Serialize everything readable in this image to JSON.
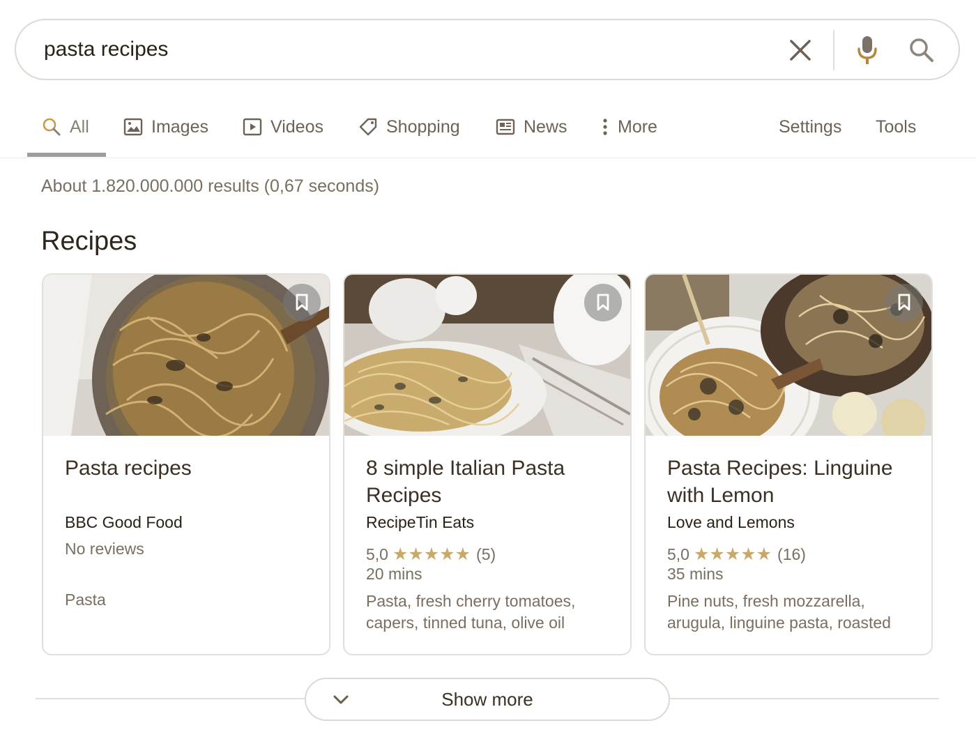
{
  "search": {
    "query": "pasta recipes"
  },
  "icons": {
    "clear": "close-icon",
    "mic": "microphone-icon",
    "search": "search-icon"
  },
  "tabs": [
    {
      "label": "All",
      "icon": "search-icon",
      "active": true
    },
    {
      "label": "Images",
      "icon": "image-icon"
    },
    {
      "label": "Videos",
      "icon": "play-icon"
    },
    {
      "label": "Shopping",
      "icon": "tag-icon"
    },
    {
      "label": "News",
      "icon": "newspaper-icon"
    },
    {
      "label": "More",
      "icon": "more-vert-icon"
    }
  ],
  "tools": {
    "settings": "Settings",
    "tools": "Tools"
  },
  "result_stats": "About 1.820.000.000 results (0,67 seconds)",
  "section_title": "Recipes",
  "cards": [
    {
      "title": "Pasta recipes",
      "source": "BBC Good Food",
      "reviews": "No reviews",
      "category": "Pasta"
    },
    {
      "title": "8 simple Italian Pasta Recipes",
      "source": "RecipeTin Eats",
      "rating": "5,0",
      "stars": "★★★★★",
      "count": "(5)",
      "time": "20 mins",
      "ingredients": "Pasta, fresh cherry tomatoes, capers, tinned tuna, olive oil"
    },
    {
      "title": "Pasta Recipes: Linguine with Lemon",
      "source": "Love and Lemons",
      "rating": "5,0",
      "stars": "★★★★★",
      "count": "(16)",
      "time": "35 mins",
      "ingredients": "Pine nuts, fresh mozzarella, arugula, linguine pasta, roasted"
    }
  ],
  "show_more": "Show more",
  "colors": {
    "accent_star": "#c9a96b",
    "text_muted": "#7a6e60",
    "text_dark": "#2a2219"
  }
}
